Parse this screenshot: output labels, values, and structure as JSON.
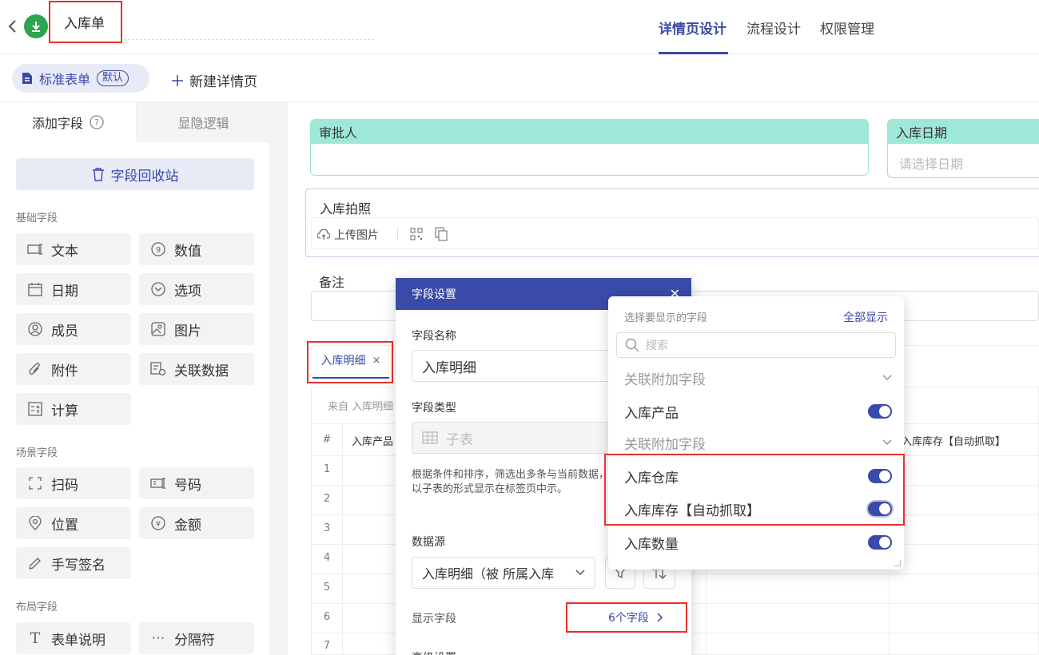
{
  "header": {
    "title": "入库单",
    "tabs": [
      {
        "label": "详情页设计",
        "active": true
      },
      {
        "label": "流程设计",
        "active": false
      },
      {
        "label": "权限管理",
        "active": false
      }
    ]
  },
  "subheader": {
    "std_form_label": "标准表单",
    "default_badge": "默认",
    "new_detail_label": "新建详情页"
  },
  "left_panel": {
    "tabs": [
      "添加字段",
      "显隐逻辑"
    ],
    "recycle_label": "字段回收站",
    "sections": {
      "basic": "基础字段",
      "scene": "场景字段",
      "layout": "布局字段"
    },
    "basic_fields": [
      "文本",
      "数值",
      "日期",
      "选项",
      "成员",
      "图片",
      "附件",
      "关联数据",
      "计算"
    ],
    "scene_fields": [
      "扫码",
      "号码",
      "位置",
      "金额",
      "手写签名"
    ],
    "layout_fields": [
      "表单说明",
      "分隔符"
    ]
  },
  "canvas": {
    "approver_label": "审批人",
    "date_label": "入库日期",
    "date_placeholder": "请选择日期",
    "photo_label": "入库拍照",
    "upload_label": "上传图片",
    "remark_label": "备注",
    "tab_label": "入库明细",
    "source_text": "来自 入库明细",
    "table_headers": [
      "#",
      "入库产品",
      "入库库存【自动抓取】"
    ],
    "row_numbers": [
      "1",
      "2",
      "3",
      "4",
      "5",
      "6",
      "7"
    ]
  },
  "modal": {
    "title": "字段设置",
    "name_label": "字段名称",
    "name_value": "入库明细",
    "type_label": "字段类型",
    "type_value": "子表",
    "desc": "根据条件和排序，筛选出多条与当前数据，以子表的形式显示在标签页中示。",
    "source_label": "数据源",
    "source_value": "入库明细（被 所属入库",
    "display_label": "显示字段",
    "display_value": "6个字段",
    "advanced_label": "高级设置"
  },
  "dropdown": {
    "title": "选择要显示的字段",
    "show_all": "全部显示",
    "search_placeholder": "搜索",
    "items": [
      {
        "label": "关联附加字段",
        "type": "group"
      },
      {
        "label": "入库产品",
        "type": "toggle",
        "on": true
      },
      {
        "label": "关联附加字段",
        "type": "group"
      },
      {
        "label": "入库仓库",
        "type": "toggle",
        "on": true
      },
      {
        "label": "入库库存【自动抓取】",
        "type": "toggle",
        "on": true
      },
      {
        "label": "入库数量",
        "type": "toggle",
        "on": true
      }
    ]
  },
  "colors": {
    "accent": "#3a4aa8",
    "highlight": "#e5322d",
    "teal": "#9ee8d8",
    "green": "#2ea44f"
  }
}
